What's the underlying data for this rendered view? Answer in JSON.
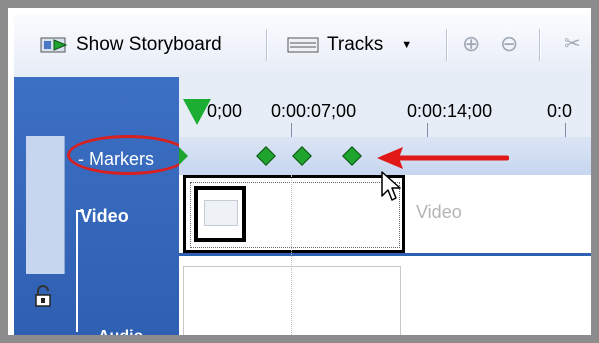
{
  "toolbar": {
    "show_storyboard": "Show Storyboard",
    "tracks": "Tracks",
    "tracks_dropdown_arrow": "▼",
    "zoom_in": "⊕",
    "zoom_out": "⊖"
  },
  "ruler": {
    "ticks": [
      "0;00",
      "0:00:07;00",
      "0:00:14;00",
      "0:0"
    ]
  },
  "tracks": {
    "markers": "- Markers",
    "video": "Video",
    "video_ghost": "Video",
    "audio": "Audio"
  },
  "colors": {
    "sidebar": "#2f5fb1",
    "marker": "#1fa52d",
    "highlight": "#d92020"
  }
}
